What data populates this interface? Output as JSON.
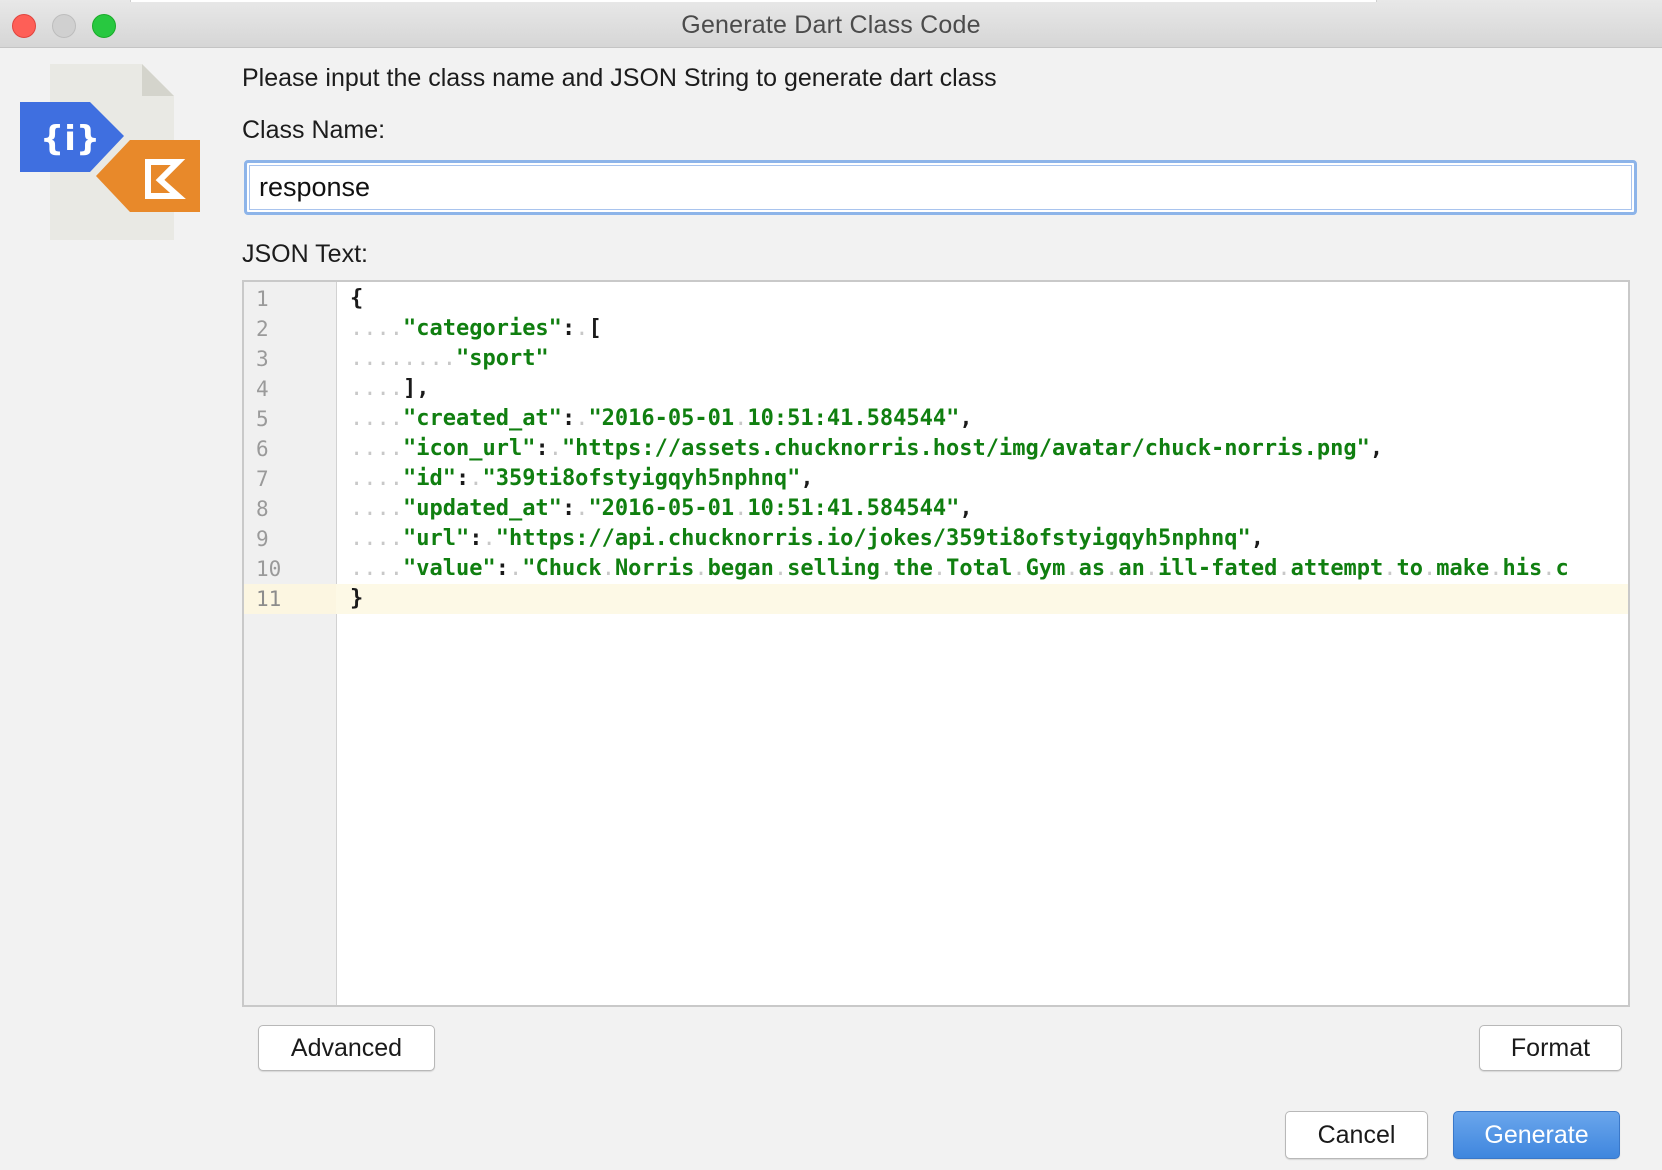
{
  "window": {
    "title": "Generate Dart Class Code"
  },
  "logo": {
    "icon": "json-to-dart-plugin-logo",
    "left_glyph": "{i}",
    "colors": {
      "blue": "#3f6fe0",
      "orange": "#e8892a",
      "page": "#e9e9e4"
    }
  },
  "prompt": "Please input the class name and JSON String to generate dart class",
  "class_name": {
    "label": "Class Name:",
    "value": "response"
  },
  "json_text": {
    "label": "JSON Text:",
    "current_line": 11,
    "lines": [
      {
        "num": "1",
        "indent": 0,
        "tokens": [
          [
            "p",
            "{"
          ]
        ]
      },
      {
        "num": "2",
        "indent": 4,
        "tokens": [
          [
            "s",
            "\"categories\""
          ],
          [
            "p",
            ":"
          ],
          [
            "d",
            "."
          ],
          [
            "p",
            "["
          ]
        ]
      },
      {
        "num": "3",
        "indent": 8,
        "tokens": [
          [
            "s",
            "\"sport\""
          ]
        ]
      },
      {
        "num": "4",
        "indent": 4,
        "tokens": [
          [
            "p",
            "],"
          ]
        ]
      },
      {
        "num": "5",
        "indent": 4,
        "tokens": [
          [
            "s",
            "\"created_at\""
          ],
          [
            "p",
            ":"
          ],
          [
            "d",
            "."
          ],
          [
            "s",
            "\"2016-05-01"
          ],
          [
            "d",
            "."
          ],
          [
            "s",
            "10:51:41.584544\""
          ],
          [
            "p",
            ","
          ]
        ]
      },
      {
        "num": "6",
        "indent": 4,
        "tokens": [
          [
            "s",
            "\"icon_url\""
          ],
          [
            "p",
            ":"
          ],
          [
            "d",
            "."
          ],
          [
            "s",
            "\"https://assets.chucknorris.host/img/avatar/chuck-norris.png\""
          ],
          [
            "p",
            ","
          ]
        ]
      },
      {
        "num": "7",
        "indent": 4,
        "tokens": [
          [
            "s",
            "\"id\""
          ],
          [
            "p",
            ":"
          ],
          [
            "d",
            "."
          ],
          [
            "s",
            "\"359ti8ofstyigqyh5nphnq\""
          ],
          [
            "p",
            ","
          ]
        ]
      },
      {
        "num": "8",
        "indent": 4,
        "tokens": [
          [
            "s",
            "\"updated_at\""
          ],
          [
            "p",
            ":"
          ],
          [
            "d",
            "."
          ],
          [
            "s",
            "\"2016-05-01"
          ],
          [
            "d",
            "."
          ],
          [
            "s",
            "10:51:41.584544\""
          ],
          [
            "p",
            ","
          ]
        ]
      },
      {
        "num": "9",
        "indent": 4,
        "tokens": [
          [
            "s",
            "\"url\""
          ],
          [
            "p",
            ":"
          ],
          [
            "d",
            "."
          ],
          [
            "s",
            "\"https://api.chucknorris.io/jokes/359ti8ofstyigqyh5nphnq\""
          ],
          [
            "p",
            ","
          ]
        ]
      },
      {
        "num": "10",
        "indent": 4,
        "tokens": [
          [
            "s",
            "\"value\""
          ],
          [
            "p",
            ":"
          ],
          [
            "d",
            "."
          ],
          [
            "s",
            "\"Chuck"
          ],
          [
            "d",
            "."
          ],
          [
            "s",
            "Norris"
          ],
          [
            "d",
            "."
          ],
          [
            "s",
            "began"
          ],
          [
            "d",
            "."
          ],
          [
            "s",
            "selling"
          ],
          [
            "d",
            "."
          ],
          [
            "s",
            "the"
          ],
          [
            "d",
            "."
          ],
          [
            "s",
            "Total"
          ],
          [
            "d",
            "."
          ],
          [
            "s",
            "Gym"
          ],
          [
            "d",
            "."
          ],
          [
            "s",
            "as"
          ],
          [
            "d",
            "."
          ],
          [
            "s",
            "an"
          ],
          [
            "d",
            "."
          ],
          [
            "s",
            "ill-fated"
          ],
          [
            "d",
            "."
          ],
          [
            "s",
            "attempt"
          ],
          [
            "d",
            "."
          ],
          [
            "s",
            "to"
          ],
          [
            "d",
            "."
          ],
          [
            "s",
            "make"
          ],
          [
            "d",
            "."
          ],
          [
            "s",
            "his"
          ],
          [
            "d",
            "."
          ],
          [
            "s",
            "c"
          ]
        ]
      },
      {
        "num": "11",
        "indent": 0,
        "tokens": [
          [
            "p",
            "}"
          ]
        ]
      }
    ]
  },
  "buttons": {
    "advanced": "Advanced",
    "format": "Format",
    "cancel": "Cancel",
    "generate": "Generate"
  },
  "colors": {
    "string": "#107f10",
    "primary_button": "#3f86de",
    "focus_ring": "#8db4e9",
    "current_line": "#fdf9e6"
  }
}
